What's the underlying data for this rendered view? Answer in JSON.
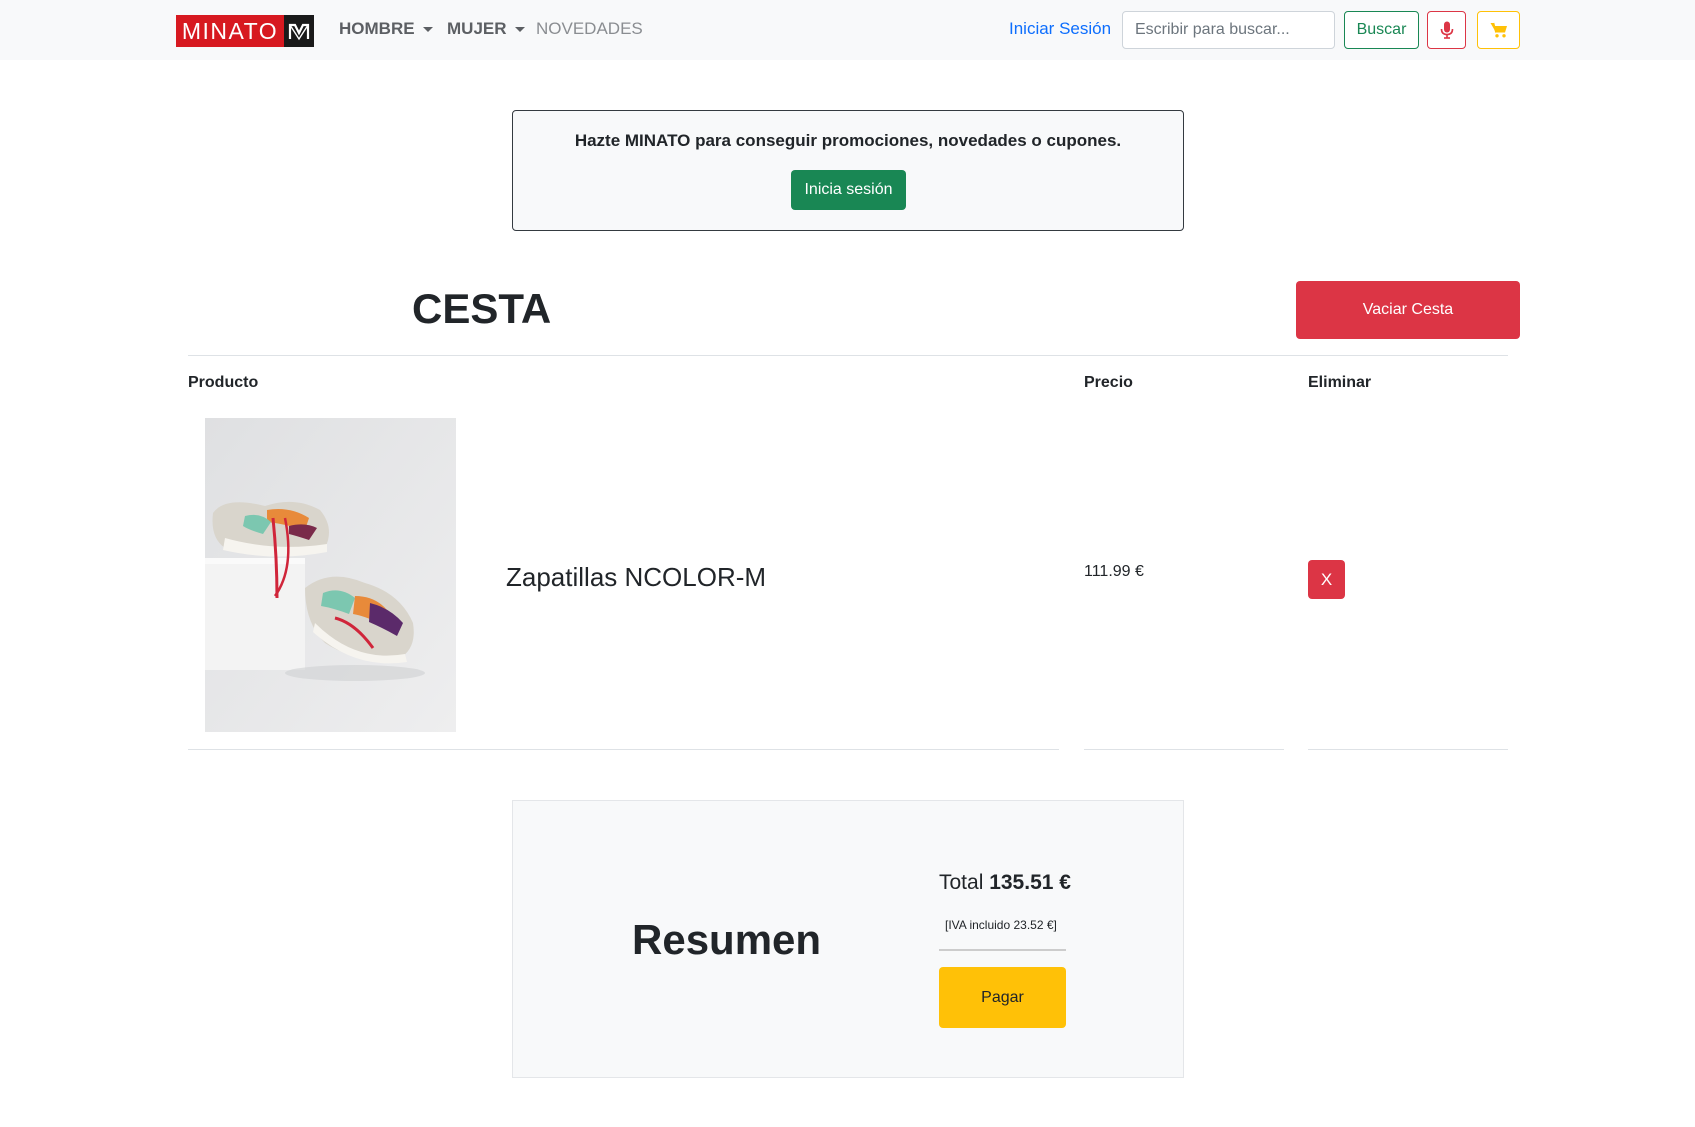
{
  "navbar": {
    "logo_text": "MINATO",
    "logo_mark": "M",
    "links": [
      "HOMBRE",
      "MUJER",
      "NOVEDADES"
    ],
    "login_label": "Iniciar Sesión",
    "search_placeholder": "Escribir para buscar...",
    "search_button": "Buscar",
    "mic_icon": "microphone-icon",
    "cart_icon": "cart-icon"
  },
  "promo": {
    "message": "Hazte MINATO para conseguir promociones, novedades o cupones.",
    "button_label": "Inicia sesión"
  },
  "cart": {
    "title": "CESTA",
    "empty_button": "Vaciar Cesta",
    "columns": [
      "Producto",
      "Precio",
      "Eliminar"
    ],
    "items": [
      {
        "name": "Zapatillas NCOLOR-M",
        "price": "111.99 €",
        "remove_label": "X"
      }
    ]
  },
  "summary": {
    "title": "Resumen",
    "total_label": "Total",
    "total_value": "135.51 €",
    "tax_note": "[IVA incluido 23.52 €]",
    "pay_button": "Pagar"
  },
  "colors": {
    "brand_red": "#d71920",
    "success": "#198754",
    "danger": "#dc3545",
    "warning": "#ffc107",
    "link": "#0d6efd"
  }
}
